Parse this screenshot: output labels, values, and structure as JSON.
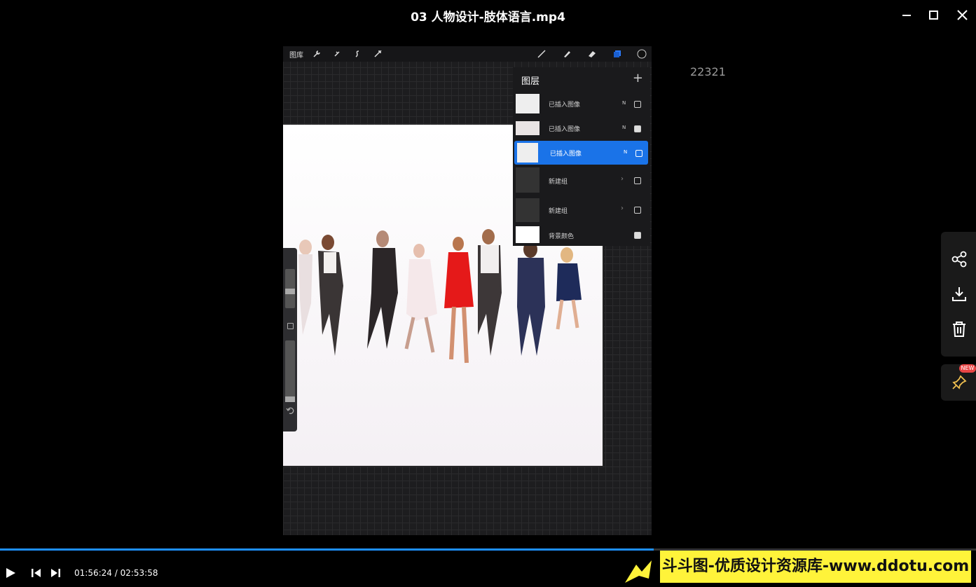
{
  "window": {
    "title": "03 人物设计-肢体语言.mp4"
  },
  "procreate": {
    "gallery_label": "图库",
    "layers_title": "图层",
    "layers": [
      {
        "name": "已插入图像",
        "mode": "N",
        "checked": false,
        "type": "image",
        "selected": false
      },
      {
        "name": "已插入图像",
        "mode": "N",
        "checked": true,
        "type": "image",
        "selected": false
      },
      {
        "name": "已插入图像",
        "mode": "N",
        "checked": false,
        "type": "image",
        "selected": true
      },
      {
        "name": "新建组",
        "mode": "",
        "checked": false,
        "type": "group",
        "selected": false
      },
      {
        "name": "新建组",
        "mode": "",
        "checked": false,
        "type": "group",
        "selected": false
      },
      {
        "name": "背景颜色",
        "mode": "",
        "checked": true,
        "type": "background",
        "selected": false
      }
    ]
  },
  "overlay_counter": "22321",
  "player": {
    "current_time": "01:56:24",
    "separator": " / ",
    "total_time": "02:53:58",
    "progress": 0.67,
    "accent": "#1e90ff"
  },
  "side_tools": [
    "share-icon",
    "download-icon",
    "trash-icon",
    "pin-icon"
  ],
  "new_badge": "NEW",
  "watermark": "斗斗图-优质设计资源库-www.ddotu.com"
}
